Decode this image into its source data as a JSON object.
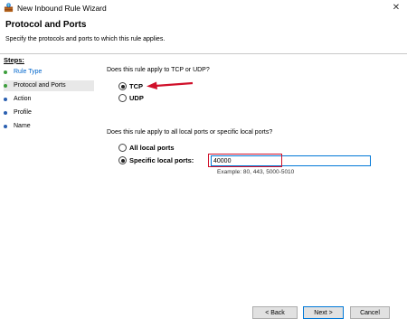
{
  "window": {
    "title": "New Inbound Rule Wizard",
    "close_glyph": "✕"
  },
  "header": {
    "title": "Protocol and Ports",
    "subtitle": "Specify the protocols and ports to which this rule applies."
  },
  "steps": {
    "heading": "Steps:",
    "items": [
      {
        "label": "Rule Type",
        "link": true,
        "bullet": "#3c9e3c"
      },
      {
        "label": "Protocol and Ports",
        "link": false,
        "bullet": "#3c9e3c"
      },
      {
        "label": "Action",
        "link": false,
        "bullet": "#2a5fb0"
      },
      {
        "label": "Profile",
        "link": false,
        "bullet": "#2a5fb0"
      },
      {
        "label": "Name",
        "link": false,
        "bullet": "#2a5fb0"
      }
    ]
  },
  "protocol": {
    "question": "Does this rule apply to TCP or UDP?",
    "options": [
      "TCP",
      "UDP"
    ],
    "selected": "TCP"
  },
  "ports": {
    "question": "Does this rule apply to all local ports or specific local ports?",
    "options": [
      "All local ports",
      "Specific local ports:"
    ],
    "selected": "Specific local ports:",
    "value": "40000",
    "example": "Example: 80, 443, 5000-5010"
  },
  "buttons": {
    "back": "< Back",
    "next": "Next >",
    "cancel": "Cancel"
  },
  "colors": {
    "annotation_red": "#d0102a",
    "focus_blue": "#0078d7"
  }
}
